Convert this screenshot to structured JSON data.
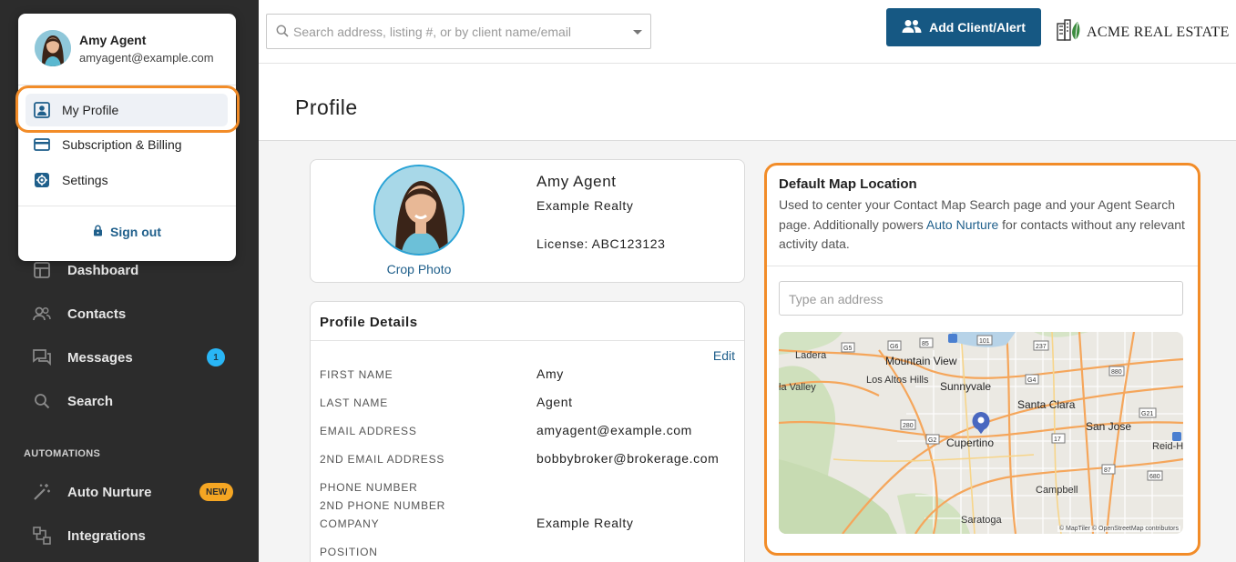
{
  "header": {
    "search_placeholder": "Search address, listing #, or by client name/email",
    "add_button_label": "Add Client/Alert",
    "brand_name": "ACME REAL ESTATE"
  },
  "page": {
    "title": "Profile"
  },
  "user_menu": {
    "name": "Amy Agent",
    "email": "amyagent@example.com",
    "items": [
      {
        "label": "My Profile",
        "icon": "profile-icon",
        "active": true
      },
      {
        "label": "Subscription & Billing",
        "icon": "credit-card-icon"
      },
      {
        "label": "Settings",
        "icon": "gear-icon"
      }
    ],
    "sign_out_label": "Sign out"
  },
  "sidebar": {
    "items": [
      {
        "label": "Dashboard",
        "icon": "dashboard-icon"
      },
      {
        "label": "Contacts",
        "icon": "contacts-icon"
      },
      {
        "label": "Messages",
        "icon": "messages-icon",
        "badge": "1"
      },
      {
        "label": "Search",
        "icon": "search-icon"
      }
    ],
    "section_label": "AUTOMATIONS",
    "automation_items": [
      {
        "label": "Auto Nurture",
        "icon": "magic-wand-icon",
        "badge": "NEW"
      },
      {
        "label": "Integrations",
        "icon": "integrations-icon"
      }
    ]
  },
  "profile_card": {
    "name": "Amy Agent",
    "company": "Example Realty",
    "license": "License: ABC123123",
    "crop_label": "Crop Photo"
  },
  "profile_details": {
    "title": "Profile Details",
    "edit_label": "Edit",
    "fields": [
      {
        "label": "FIRST NAME",
        "value": "Amy"
      },
      {
        "label": "LAST NAME",
        "value": "Agent"
      },
      {
        "label": "EMAIL ADDRESS",
        "value": "amyagent@example.com"
      },
      {
        "label": "2ND EMAIL ADDRESS",
        "value": "bobbybroker@brokerage.com"
      },
      {
        "label": "PHONE NUMBER",
        "value": ""
      },
      {
        "label": "2ND PHONE NUMBER",
        "value": ""
      },
      {
        "label": "COMPANY",
        "value": "Example Realty"
      },
      {
        "label": "POSITION",
        "value": ""
      }
    ]
  },
  "map_location": {
    "title": "Default Map Location",
    "description_before": "Used to center your Contact Map Search page and your Agent Search page. Additionally powers ",
    "description_link": "Auto Nurture",
    "description_after": " for contacts without any relevant activity data.",
    "address_placeholder": "Type an address",
    "attribution": "© MapTiler © OpenStreetMap contributors",
    "places": [
      "Mountain View",
      "Sunnyvale",
      "Santa Clara",
      "San Jose",
      "Cupertino",
      "Campbell",
      "Saratoga",
      "Los Altos Hills",
      "Ladera",
      "Reid-Hill Airpo",
      "la Valley"
    ],
    "road_shields": [
      "G5",
      "G6",
      "85",
      "101",
      "237",
      "880",
      "G4",
      "280",
      "G2",
      "680",
      "87",
      "G21",
      "17"
    ]
  },
  "colors": {
    "sidebar_bg": "#2c2c2c",
    "primary": "#165883",
    "highlight": "#f28c28",
    "badge_blue": "#29b6f6",
    "badge_orange": "#f5a623"
  }
}
